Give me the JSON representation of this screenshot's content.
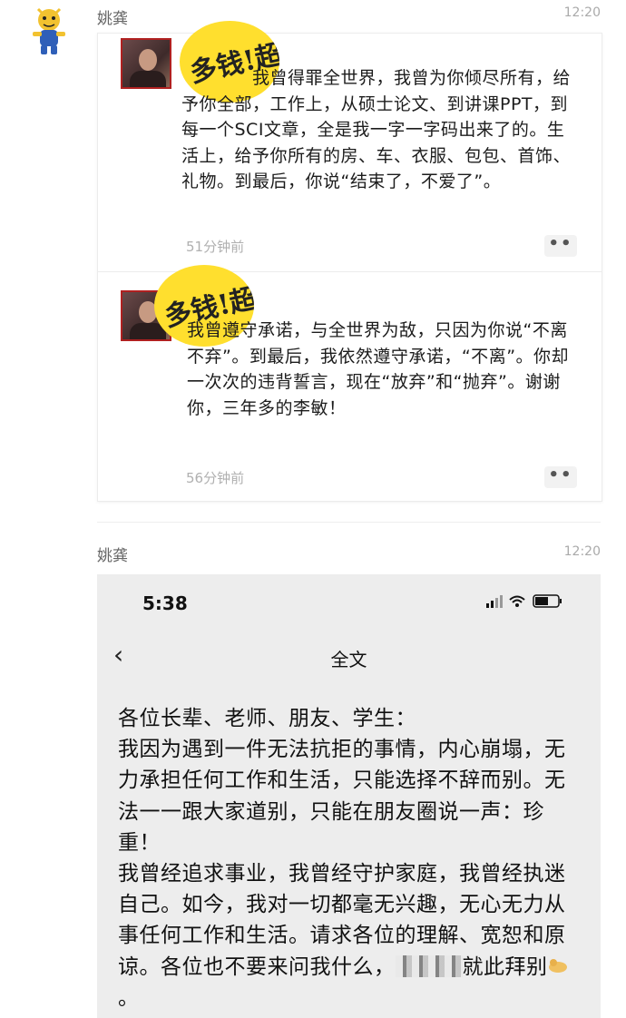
{
  "moment1": {
    "sender": "姚龚",
    "time": "12:20",
    "sticker_text": "多钱!超",
    "posts": [
      {
        "text": "我曾得罪全世界，我曾为你倾尽所有，给予你全部，工作上，从硕士论文、到讲课PPT，到每一个SCI文章，全是我一字一字码出来了的。生活上，给予你所有的房、车、衣服、包包、首饰、礼物。到最后，你说“结束了，不爱了”。",
        "ago": "51分钟前",
        "more": "••"
      },
      {
        "text": "我曾遵守承诺，与全世界为敌，只因为你说“不离不弃”。到最后，我依然遵守承诺，“不离”。你却一次次的违背誓言，现在“放弃”和“抛弃”。谢谢你，三年多的李敏！",
        "ago": "56分钟前",
        "more": "••"
      }
    ]
  },
  "moment2": {
    "sender": "姚龚",
    "time": "12:20",
    "phone": {
      "status_time": "5:38",
      "status_icons": "signal wifi battery",
      "back": "‹",
      "title": "全文",
      "text_before_blur": "各位长辈、老师、朋友、学生：\n我因为遇到一件无法抗拒的事情，内心崩塌，无力承担任何工作和生活，只能选择不辞而别。无法一一跟大家道别，只能在朋友圈说一声：珍重！\n我曾经追求事业，我曾经守护家庭，我曾经执迷自己。如今，我对一切都毫无兴趣，无心无力从事任何工作和生活。请求各位的理解、宽恕和原谅。各位也不要来问我什么，",
      "text_after_blur": "就此拜别",
      "end_mark": "。",
      "bow_icon": "bow-emoji-icon"
    }
  },
  "colors": {
    "sticker": "#ffdf2e",
    "phone_bg": "#ededed",
    "muted": "#b0b0b0"
  }
}
